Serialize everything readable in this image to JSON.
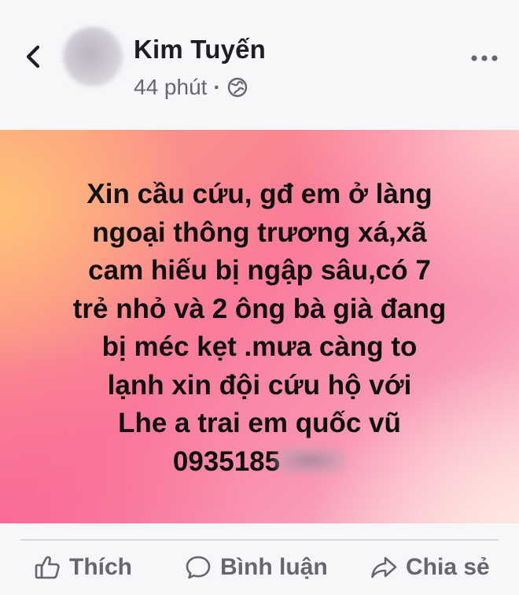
{
  "header": {
    "author_name": "Kim Tuyến",
    "time": "44 phút",
    "separator": "·",
    "back_icon": "chevron-left-icon",
    "privacy_icon": "globe-icon",
    "more_icon": "more-horizontal-icon"
  },
  "post": {
    "lines": [
      "Xin cầu cứu, gđ em ở làng",
      "ngoại thông trương xá,xã",
      "cam hiếu  bị ngập sâu,có 7",
      "trẻ nhỏ và 2 ông bà già đang",
      "bị méc kẹt .mưa càng to",
      "lạnh xin đội cứu hộ với",
      "Lhe a trai em quốc vũ",
      "0935185"
    ],
    "background_colors": [
      "#fba07e",
      "#fa7b9a",
      "#f99ab6",
      "#fbd3d3"
    ]
  },
  "actions": {
    "like_label": "Thích",
    "comment_label": "Bình luận",
    "share_label": "Chia sẻ",
    "like_icon": "thumbs-up-icon",
    "comment_icon": "comment-icon",
    "share_icon": "share-icon"
  }
}
